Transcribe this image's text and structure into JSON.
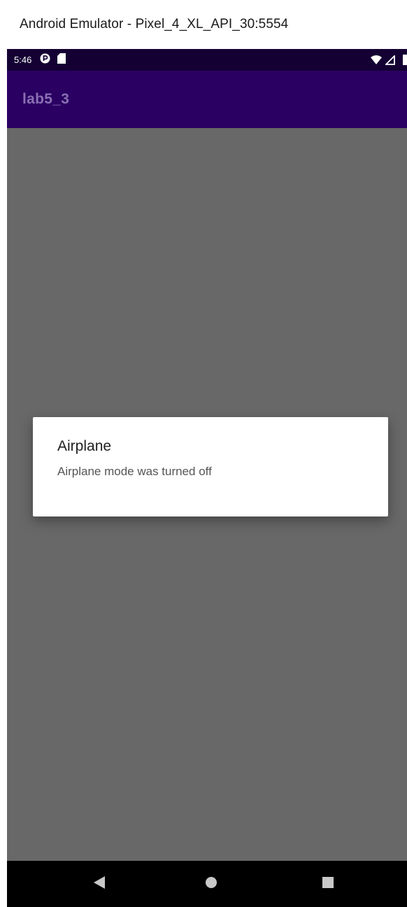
{
  "window": {
    "title": "Android Emulator - Pixel_4_XL_API_30:5554"
  },
  "status_bar": {
    "time": "5:46",
    "icons_left": [
      "notification-p-icon",
      "sd-card-icon"
    ],
    "icons_right": [
      "wifi-icon",
      "cell-signal-icon",
      "battery-icon"
    ]
  },
  "app_bar": {
    "title": "lab5_3"
  },
  "dialog": {
    "title": "Airplane",
    "message": "Airplane mode was turned off"
  },
  "nav_bar": {
    "icons": [
      "back-icon",
      "home-icon",
      "recents-icon"
    ]
  },
  "colors": {
    "status_bar": "#140033",
    "app_bar": "#2a0062",
    "app_title": "#8a6fb3",
    "scrim": "#686868",
    "dialog_bg": "#ffffff",
    "nav_bar": "#000000"
  }
}
